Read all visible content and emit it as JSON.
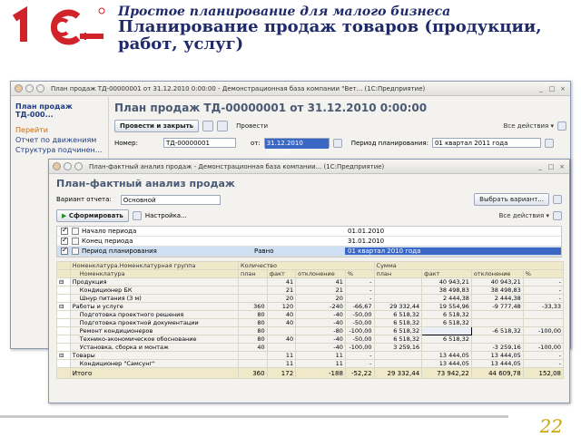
{
  "slide": {
    "logo_text": "1С",
    "title_line1": "Простое планирование для малого бизнеса",
    "title_line2": "Планирование продаж товаров (продукции,",
    "title_line3": "работ, услуг)",
    "page_number": "22"
  },
  "window1": {
    "title": "План продаж ТД-00000001 от 31.12.2010 0:00:00 - Демонстрационная база компании \"Вет...  (1С:Предприятие)",
    "sidebar": {
      "doc": "План продаж ТД-000...",
      "group": "Перейти",
      "links": [
        "Отчет по движениям",
        "Структура подчинен..."
      ]
    },
    "heading": "План продаж ТД-00000001 от 31.12.2010 0:00:00",
    "post_close": "Провести и закрыть",
    "post": "Провести",
    "all_actions": "Все действия ▾",
    "number_label": "Номер:",
    "number_value": "ТД-00000001",
    "from_label": "от:",
    "date_value": "31.12.2010  0:00:00",
    "period_label": "Период планирования:",
    "period_value": "01 квартал 2011 года"
  },
  "window2": {
    "title": "План-фактный анализ продаж - Демонстрационная база компании... (1С:Предприятие)",
    "heading": "План-фактный анализ продаж",
    "variant_label": "Вариант отчета:",
    "variant_value": "Основной",
    "choose_variant": "Выбрать вариант...",
    "generate": "Сформировать",
    "settings": "Настройка...",
    "all_actions": "Все действия ▾",
    "params": [
      {
        "name": "Начало периода",
        "cond": "",
        "value": "01.01.2010"
      },
      {
        "name": "Конец периода",
        "cond": "",
        "value": "31.01.2010"
      },
      {
        "name": "Период планирования",
        "cond": "Равно",
        "value": "01 квартал 2010 года"
      }
    ],
    "table": {
      "h1": [
        "Номенклатура.Номенклатурная группа",
        "Количество",
        "Сумма"
      ],
      "h2_name": "Номенклатура",
      "h2": [
        "план",
        "факт",
        "отклонение",
        "%",
        "план",
        "факт",
        "отклонение",
        "%"
      ],
      "rows": [
        {
          "name": "Продукция",
          "lvl": 0,
          "v": [
            "",
            "41",
            "41",
            "-",
            "",
            "40 943,21",
            "40 943,21",
            "-"
          ]
        },
        {
          "name": "Кондиционер БК",
          "lvl": 1,
          "v": [
            "",
            "21",
            "21",
            "-",
            "",
            "38 498,83",
            "38 498,83",
            "-"
          ]
        },
        {
          "name": "Шнур питания (3 м)",
          "lvl": 1,
          "v": [
            "",
            "20",
            "20",
            "-",
            "",
            "2 444,38",
            "2 444,38",
            "-"
          ]
        },
        {
          "name": "Работы и услуге",
          "lvl": 0,
          "v": [
            "360",
            "120",
            "-240",
            "-66,67",
            "29 332,44",
            "19 554,96",
            "-9 777,48",
            "-33,33"
          ]
        },
        {
          "name": "Подготовка проектного решения",
          "lvl": 1,
          "v": [
            "80",
            "40",
            "-40",
            "-50,00",
            "6 518,32",
            "6 518,32",
            "",
            ""
          ]
        },
        {
          "name": "Подготовка проектной документации",
          "lvl": 1,
          "v": [
            "80",
            "40",
            "-40",
            "-50,00",
            "6 518,32",
            "6 518,32",
            "",
            ""
          ]
        },
        {
          "name": "Ремонт кондиционеров",
          "lvl": 1,
          "v": [
            "80",
            "",
            "-80",
            "-100,00",
            "6 518,32",
            "",
            "-6 518,32",
            "-100,00"
          ]
        },
        {
          "name": "Технико-экономическое обоснование",
          "lvl": 1,
          "v": [
            "80",
            "40",
            "-40",
            "-50,00",
            "6 518,32",
            "6 518,32",
            "",
            ""
          ]
        },
        {
          "name": "Установка, сборка и монтаж",
          "lvl": 1,
          "v": [
            "40",
            "",
            "-40",
            "-100,00",
            "3 259,16",
            "",
            "-3 259,16",
            "-100,00"
          ]
        },
        {
          "name": "Товары",
          "lvl": 0,
          "v": [
            "",
            "11",
            "11",
            "-",
            "",
            "13 444,05",
            "13 444,05",
            "-"
          ]
        },
        {
          "name": "Кондиционер \"Самсунг\"",
          "lvl": 1,
          "v": [
            "",
            "11",
            "11",
            "-",
            "",
            "13 444,05",
            "13 444,05",
            "-"
          ]
        }
      ],
      "total": {
        "name": "Итого",
        "v": [
          "360",
          "172",
          "-188",
          "-52,22",
          "29 332,44",
          "73 942,22",
          "44 609,78",
          "152,08"
        ]
      }
    }
  },
  "colors": {
    "brand_red": "#d1232a",
    "title_blue": "#1f2a6b",
    "header_beige": "#efe8c9",
    "selection": "#3b68c4"
  }
}
